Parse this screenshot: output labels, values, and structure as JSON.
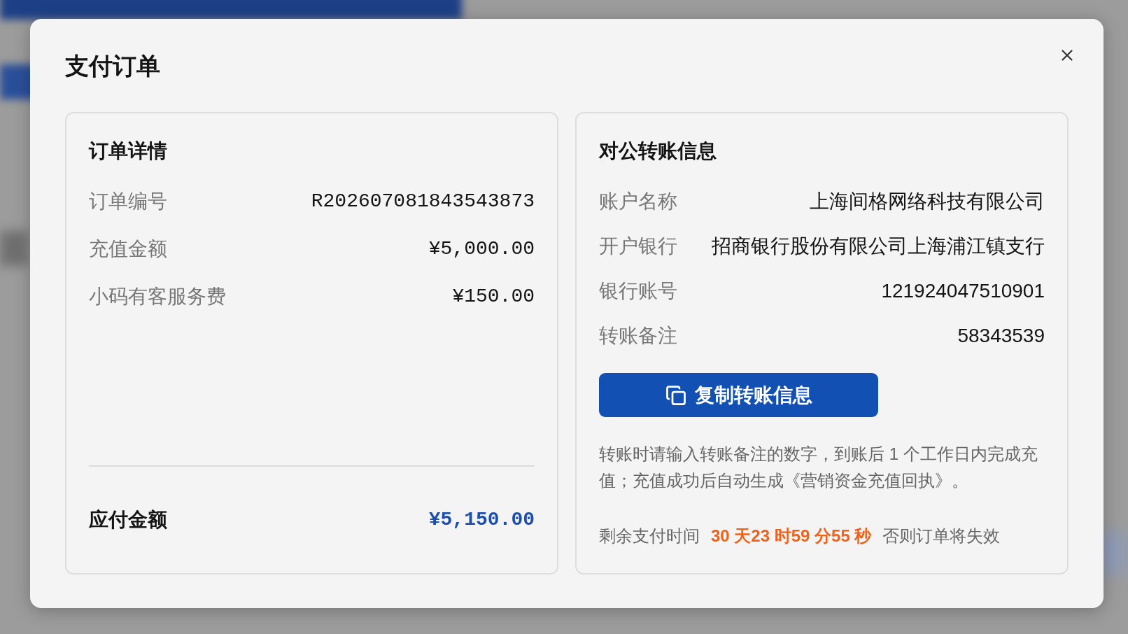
{
  "dialog": {
    "title": "支付订单",
    "order_details": {
      "heading": "订单详情",
      "rows": [
        {
          "label": "订单编号",
          "value": "R202607081843543873"
        },
        {
          "label": "充值金额",
          "value": "¥5,000.00"
        },
        {
          "label": "小码有客服务费",
          "value": "¥150.00"
        }
      ],
      "total": {
        "label": "应付金额",
        "value": "¥5,150.00"
      }
    },
    "transfer_info": {
      "heading": "对公转账信息",
      "rows": [
        {
          "label": "账户名称",
          "value": "上海间格网络科技有限公司"
        },
        {
          "label": "开户银行",
          "value": "招商银行股份有限公司上海浦江镇支行"
        },
        {
          "label": "银行账号",
          "value": "121924047510901"
        },
        {
          "label": "转账备注",
          "value": "58343539"
        }
      ],
      "copy_button": "复制转账信息",
      "note": "转账时请输入转账备注的数字，到账后 1 个工作日内完成充值；充值成功后自动生成《营销资金充值回执》。",
      "countdown": {
        "label": "剩余支付时间",
        "value": "30 天23 时59 分55 秒",
        "suffix": "否则订单将失效"
      }
    }
  }
}
